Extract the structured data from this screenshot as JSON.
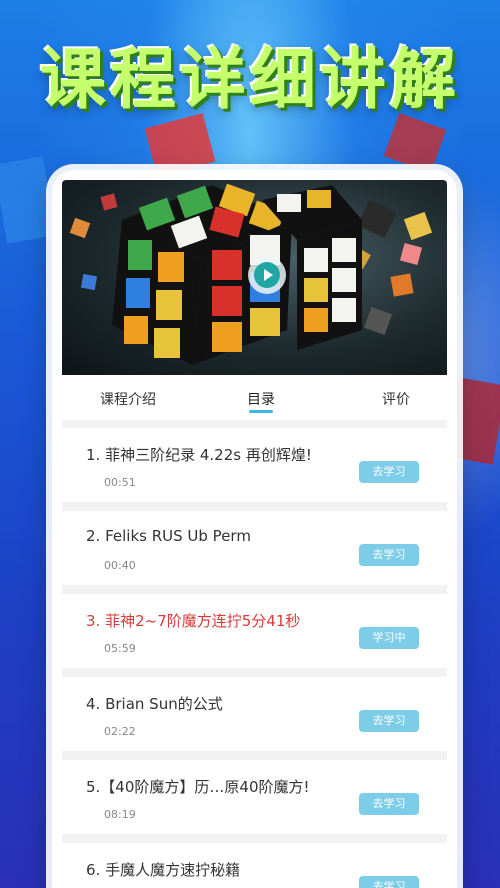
{
  "headline": "课程详细讲解",
  "video": {
    "play_icon": "play-icon"
  },
  "tabs": [
    {
      "label": "课程介绍"
    },
    {
      "label": "目录"
    },
    {
      "label": "评价"
    }
  ],
  "lessons": [
    {
      "title": "1. 菲神三阶纪录 4.22s 再创辉煌!",
      "duration": "00:51",
      "button": "去学习",
      "active": false
    },
    {
      "title": "2. Feliks RUS Ub Perm",
      "duration": "00:40",
      "button": "去学习",
      "active": false
    },
    {
      "title": "3. 菲神2~7阶魔方连拧5分41秒",
      "duration": "05:59",
      "button": "学习中",
      "active": true
    },
    {
      "title": "4. Brian Sun的公式",
      "duration": "02:22",
      "button": "去学习",
      "active": false
    },
    {
      "title": "5.【40阶魔方】历…原40阶魔方!",
      "duration": "08:19",
      "button": "去学习",
      "active": false
    },
    {
      "title": "6. 手魔人魔方速拧秘籍",
      "duration": "",
      "button": "去学习",
      "active": false
    }
  ],
  "colors": {
    "accent": "#3cb8e6",
    "button": "#7dcde8",
    "active_text": "#d93a3a",
    "headline": "#c6ff6c"
  }
}
